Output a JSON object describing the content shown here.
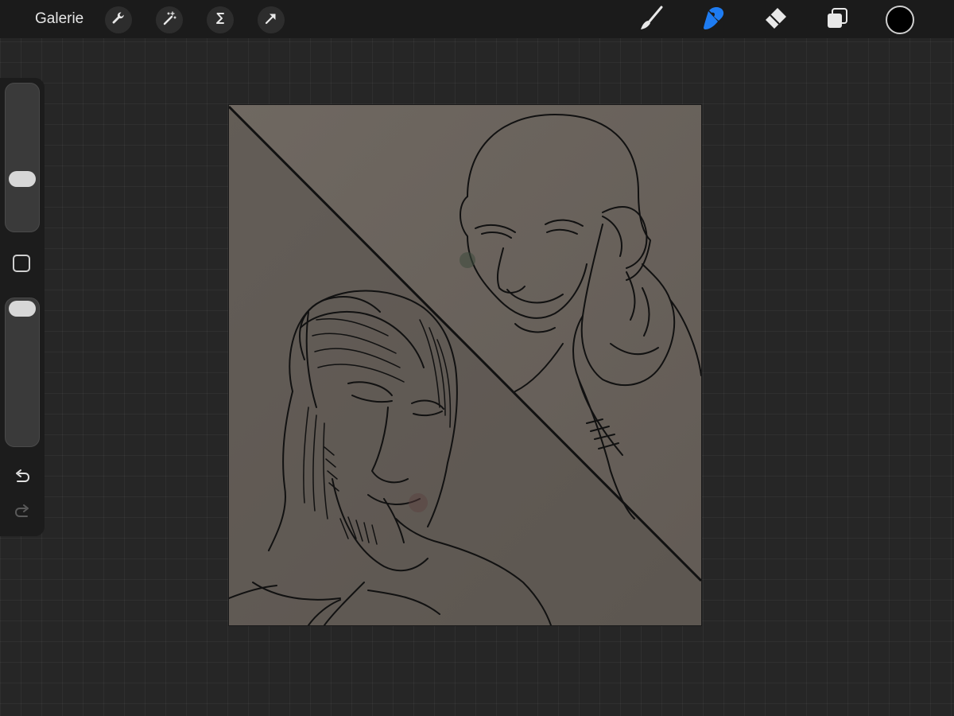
{
  "topbar": {
    "gallery_label": "Galerie",
    "actions": [
      "wrench-icon",
      "magic-wand-icon",
      "selection-icon",
      "transform-arrow-icon"
    ],
    "tools": [
      "brush-icon",
      "smudge-icon",
      "eraser-icon",
      "layers-icon"
    ],
    "active_tool": "smudge-icon",
    "active_tool_color": "#1e7cf2",
    "current_color": "#000000"
  },
  "sidebar": {
    "brush_size_level": 0.34,
    "opacity_level": 1.0,
    "icons": [
      "modify-square-icon",
      "undo-icon",
      "redo-icon"
    ]
  },
  "canvas": {
    "background_color": "#6d665f",
    "shadow_color": "#5a544e",
    "line_color": "#111111"
  }
}
